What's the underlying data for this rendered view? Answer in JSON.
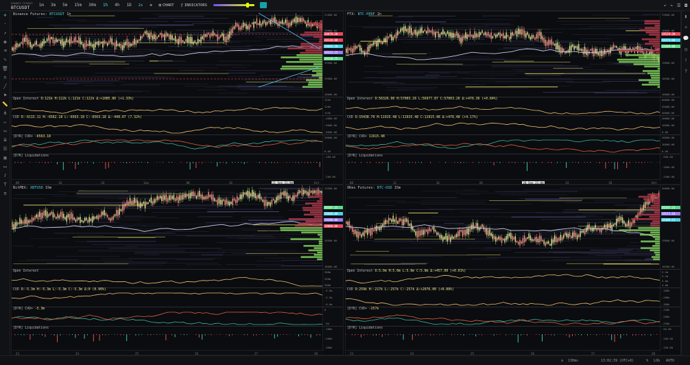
{
  "topbar": {
    "exchange": "BINANCE FUTURES",
    "symbol": "BTCUSDT",
    "timeframes": [
      "1m",
      "3m",
      "5m",
      "15m",
      "30m",
      "1h",
      "4h",
      "1D"
    ],
    "active_timeframe": "1h",
    "chart_label": "CHART",
    "indicators_label": "INDICATORS",
    "layout_label": "2s"
  },
  "panels": [
    {
      "title": "Binance Futures:",
      "ticker": "BTCUSDT",
      "tf": "1h",
      "oi_label": "Open Interest",
      "oi_vals": "O:121k H:122k L:121k C:122k Δ:+1085.86 (+1.33%)",
      "cvd_label": "CVD",
      "cvd_vals": "O:-6115.11 H:-6562.18 L:-6563.18 C:-6563.18 Δ:-448.07 (7.32%)",
      "cvd2_label": "[D?R] CVD+",
      "cvd2_val": "-6563.18",
      "liq_label": "[D?R] Liquidations",
      "yticks_main": [
        "21000.00",
        "20800.00",
        "20000.00",
        "19500.00",
        "19000.00",
        "18000.00"
      ],
      "tags": [
        {
          "t": "20879.20",
          "c": "#e84a5f"
        },
        {
          "t": "20120.00",
          "c": "#e84a5f"
        },
        {
          "t": "19645.18",
          "c": "#4fd1e5"
        },
        {
          "t": "19323.23",
          "c": "#9c7bff"
        },
        {
          "t": "19218.75",
          "c": "#58d98b"
        }
      ],
      "yticks_oi": [
        "125k",
        "120k",
        "115k"
      ],
      "yticks_cvd": [
        "-4000.00",
        "-6000.00",
        "-8000.00"
      ],
      "yticks_cvd2": [
        "20000.00",
        "0.00"
      ],
      "yticks_liq": [
        "-100.00",
        "-200.00"
      ],
      "xticks": [
        "09",
        "16",
        "24",
        "Sep",
        "08",
        "16",
        "21 Sep 21:00",
        "Oct"
      ]
    },
    {
      "title": "FTX:",
      "ticker": "BTC-PERF",
      "tf": "1h",
      "oi_label": "Open Interest",
      "oi_vals": "O:56326.90 H:57003.26 L:56977.87 C:57003.26 Δ:+476.36 (+0.84%)",
      "cvd_label": "CVD",
      "cvd_vals": "O:15438.79 H:11915.48 L:11915.48 C:11915.48 Δ:+476.48 (+4.17%)",
      "cvd2_label": "[D?R] CVD+",
      "cvd2_val": "11915.48",
      "liq_label": "[D?R] Liquidations",
      "yticks_main": [
        "23000.00",
        "20000.00",
        "19500.00",
        "19000.00",
        "18500.00",
        "18000.00"
      ],
      "tags": [
        {
          "t": "19529.30",
          "c": "#e84a5f"
        },
        {
          "t": "19274.00",
          "c": "#4fd1e5"
        },
        {
          "t": "19209.00",
          "c": "#58d98b"
        }
      ],
      "yticks_oi": [
        "60000.00",
        "55000.00",
        "50000.00"
      ],
      "yticks_cvd": [
        "20000.00",
        "10000.00",
        "0.00"
      ],
      "yticks_cvd2": [
        "20000.00",
        "10000.00",
        "0.00"
      ],
      "yticks_liq": [
        "-500.00",
        "-1000.00",
        "-1500.00"
      ],
      "xticks": [
        "08",
        "12",
        "16",
        "20",
        "28 Sep 21:00",
        "24",
        "28",
        "Oct"
      ]
    },
    {
      "title": "BitMEX:",
      "ticker": "XBTUSD",
      "tf": "15m",
      "oi_label": "Open Interest",
      "oi_vals": "",
      "cvd_label": "CVD",
      "cvd_vals": "O:-5.3m H:-5.3m L:-5.3m C:-5.3m Δ:0 (0.00%)",
      "cvd2_label": "[D?R] CVD+",
      "cvd2_val": "-5.3m",
      "liq_label": "[D?R] Liquidations",
      "yticks_main": [
        "19500.00",
        "19000.00",
        "18500.00",
        "18000.00"
      ],
      "tags": [
        {
          "t": "20187.23",
          "c": "#58d98b"
        },
        {
          "t": "19600.00",
          "c": "#4fd1e5"
        },
        {
          "t": "19200.00",
          "c": "#9c7bff"
        },
        {
          "t": "19000.00",
          "c": "#e84a5f"
        }
      ],
      "yticks_oi": [
        "300m",
        "250m",
        "200m"
      ],
      "yticks_cvd": [
        "-5.0m",
        "-5.5m",
        "-6.0m"
      ],
      "yticks_cvd2": [
        "0",
        "-5m"
      ],
      "yticks_liq": [
        "-100k",
        "-200k",
        "-300k"
      ],
      "xticks": [
        "23",
        "24",
        "25",
        "26",
        "27",
        "28"
      ]
    },
    {
      "title": "OKex Futures:",
      "ticker": "BTC-USD",
      "tf": "15m",
      "oi_label": "Open Interest",
      "oi_vals": "O:5.0m H:5.0m L:5.0m C:5.0m Δ:+457.00 (+0.01%)",
      "cvd_label": "CVD",
      "cvd_vals": "O:259k H:-217k L:-257k C:-257k Δ:+2076.00 (+0.08%)",
      "cvd2_label": "[D?R] CVD+",
      "cvd2_val": "-257k",
      "liq_label": "[D?R] Liquidations",
      "yticks_main": [
        "20000.00",
        "19500.00",
        "19000.00",
        "18500.00"
      ],
      "tags": [
        {
          "t": "20187.23",
          "c": "#58d98b"
        },
        {
          "t": "19515.10",
          "c": "#9c7bff"
        },
        {
          "t": "19309.23",
          "c": "#4fd1e5"
        }
      ],
      "yticks_oi": [
        "5.4m",
        "5.2m",
        "5.0m",
        "4.8m"
      ],
      "yticks_cvd": [
        "-100k",
        "-200k",
        "-300k"
      ],
      "yticks_cvd2": [
        "-150k",
        "-200k",
        "-250k"
      ],
      "yticks_liq": [
        "-50.00",
        "-100.00",
        "-150.00"
      ],
      "xticks": [
        "23",
        "24",
        "25",
        "26",
        "27",
        "28"
      ]
    }
  ],
  "status": {
    "latency": "130ms",
    "time": "13:02:39 (UTC+8)",
    "pct": "%",
    "log": "LOG",
    "auto": "AUTO"
  }
}
